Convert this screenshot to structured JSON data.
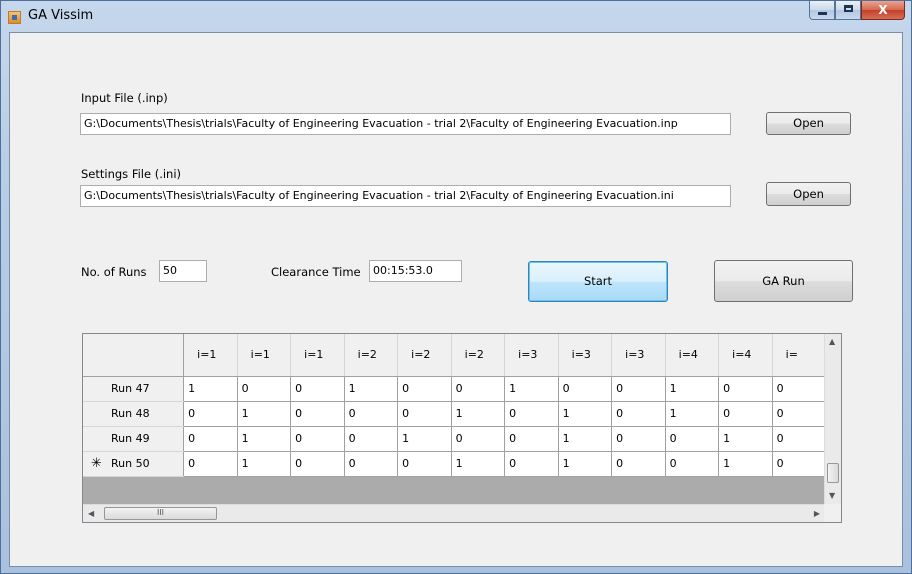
{
  "window": {
    "title": "GA Vissim"
  },
  "caption": {
    "minimize": "",
    "maximize": "",
    "close": "X"
  },
  "input_file": {
    "label": "Input File (.inp)",
    "value": "G:\\Documents\\Thesis\\trials\\Faculty of Engineering Evacuation - trial 2\\Faculty of Engineering Evacuation.inp",
    "open_label": "Open"
  },
  "settings_file": {
    "label": "Settings File (.ini)",
    "value": "G:\\Documents\\Thesis\\trials\\Faculty of Engineering Evacuation - trial 2\\Faculty of Engineering Evacuation.ini",
    "open_label": "Open"
  },
  "runs": {
    "label": "No. of Runs",
    "value": "50"
  },
  "clearance": {
    "label": "Clearance Time",
    "value": "00:15:53.0"
  },
  "buttons": {
    "start": "Start",
    "ga_run": "GA Run"
  },
  "grid": {
    "columns": [
      "i=1",
      "i=1",
      "i=1",
      "i=2",
      "i=2",
      "i=2",
      "i=3",
      "i=3",
      "i=3",
      "i=4",
      "i=4",
      "i="
    ],
    "rows": [
      {
        "header": "Run 47",
        "marker": "",
        "cells": [
          "1",
          "0",
          "0",
          "1",
          "0",
          "0",
          "1",
          "0",
          "0",
          "1",
          "0",
          "0"
        ]
      },
      {
        "header": "Run 48",
        "marker": "",
        "cells": [
          "0",
          "1",
          "0",
          "0",
          "0",
          "1",
          "0",
          "1",
          "0",
          "1",
          "0",
          "0"
        ]
      },
      {
        "header": "Run 49",
        "marker": "",
        "cells": [
          "0",
          "1",
          "0",
          "0",
          "1",
          "0",
          "0",
          "1",
          "0",
          "0",
          "1",
          "0"
        ]
      },
      {
        "header": "Run 50",
        "marker": "✳",
        "cells": [
          "0",
          "1",
          "0",
          "0",
          "0",
          "1",
          "0",
          "1",
          "0",
          "0",
          "1",
          "0"
        ]
      }
    ],
    "hscroll_thumb": "III"
  }
}
